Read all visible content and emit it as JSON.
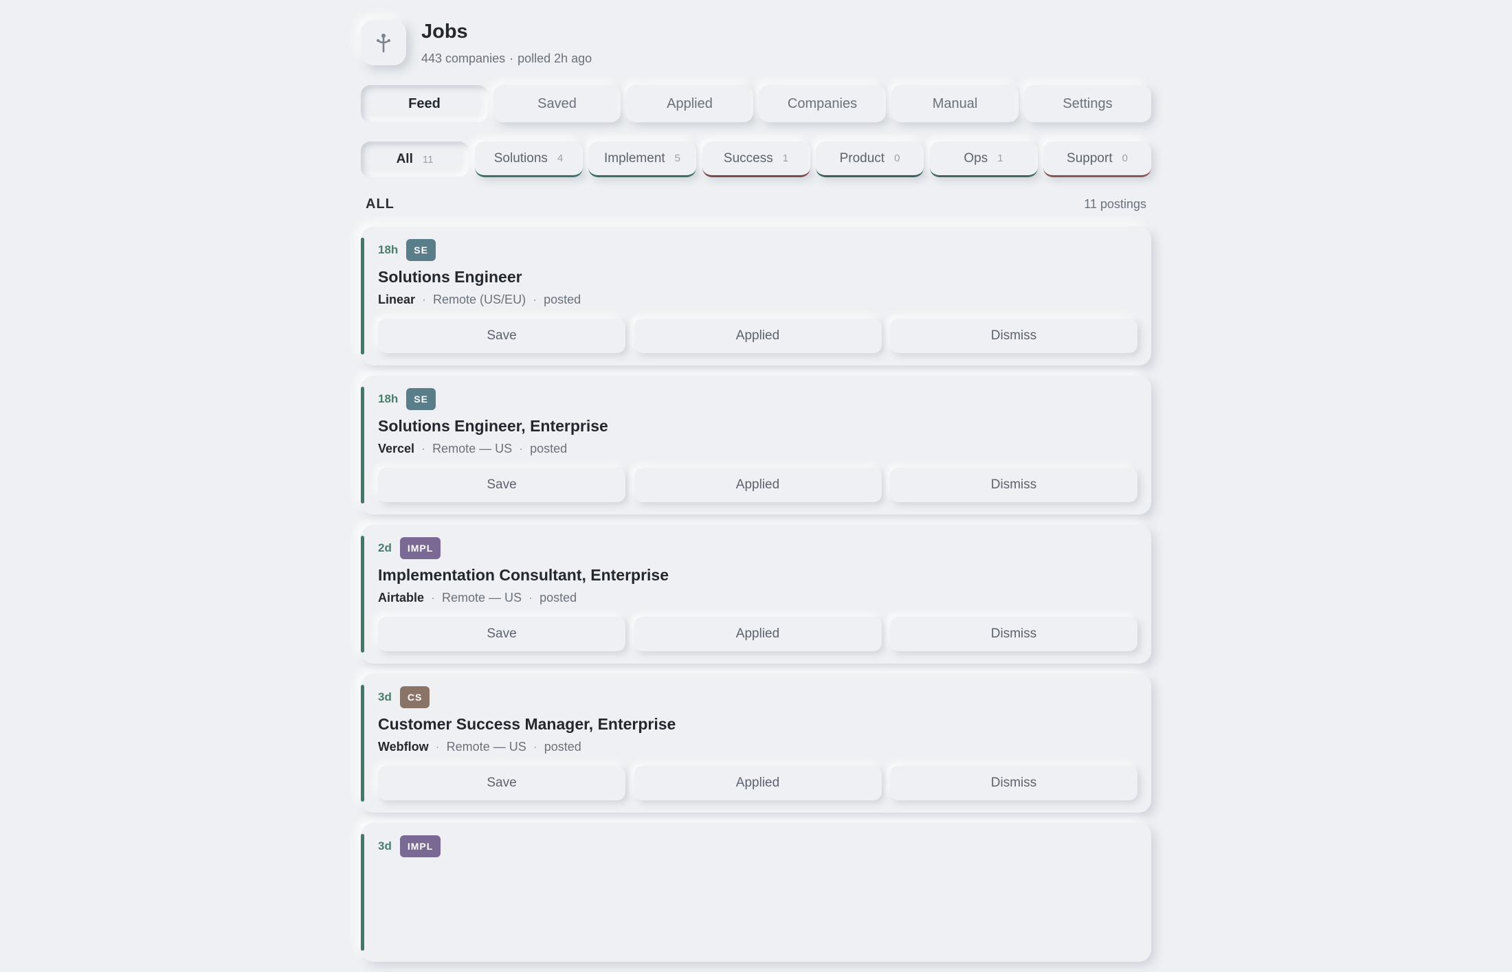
{
  "header": {
    "logo_icon": "antenna-icon",
    "title": "Jobs",
    "companies": "443 companies",
    "separator": "·",
    "polled": "polled 2h ago"
  },
  "tabs": [
    {
      "label": "Feed",
      "active": true
    },
    {
      "label": "Saved",
      "active": false
    },
    {
      "label": "Applied",
      "active": false
    },
    {
      "label": "Companies",
      "active": false
    },
    {
      "label": "Manual",
      "active": false
    },
    {
      "label": "Settings",
      "active": false
    }
  ],
  "filters": [
    {
      "label": "All",
      "count": "11",
      "active": true
    },
    {
      "label": "Solutions",
      "count": "4",
      "active": false
    },
    {
      "label": "Implement",
      "count": "5",
      "active": false
    },
    {
      "label": "Success",
      "count": "1",
      "active": false
    },
    {
      "label": "Product",
      "count": "0",
      "active": false
    },
    {
      "label": "Ops",
      "count": "1",
      "active": false
    },
    {
      "label": "Support",
      "count": "0",
      "active": false
    }
  ],
  "section": {
    "title": "ALL",
    "count": "11 postings"
  },
  "badge_colors": {
    "SE": "#5a7d8a",
    "IMPL": "#7a6895",
    "CS": "#8a7468"
  },
  "actions": {
    "save": "Save",
    "applied": "Applied",
    "dismiss": "Dismiss"
  },
  "jobs": [
    {
      "age": "18h",
      "badge": "SE",
      "title": "Solutions Engineer",
      "company": "Linear",
      "location": "Remote (US/EU)",
      "status": "posted"
    },
    {
      "age": "18h",
      "badge": "SE",
      "title": "Solutions Engineer, Enterprise",
      "company": "Vercel",
      "location": "Remote — US",
      "status": "posted"
    },
    {
      "age": "2d",
      "badge": "IMPL",
      "title": "Implementation Consultant, Enterprise",
      "company": "Airtable",
      "location": "Remote — US",
      "status": "posted"
    },
    {
      "age": "3d",
      "badge": "CS",
      "title": "Customer Success Manager, Enterprise",
      "company": "Webflow",
      "location": "Remote — US",
      "status": "posted"
    },
    {
      "age": "3d",
      "badge": "IMPL",
      "title": "",
      "company": "",
      "location": "",
      "status": ""
    }
  ]
}
